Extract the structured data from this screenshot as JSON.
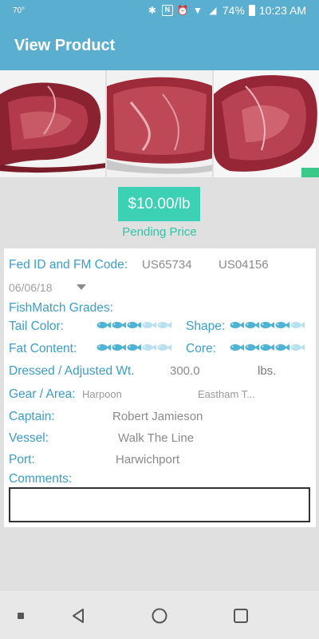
{
  "status_bar": {
    "temperature": "70°",
    "battery": "74%",
    "time": "10:23 AM"
  },
  "app_bar": {
    "title": "View Product"
  },
  "price": {
    "label": "$10.00/lb",
    "status": "Pending Price"
  },
  "product": {
    "fed_id_label": "Fed ID and FM Code:",
    "fed_id": "US65734",
    "fm_code": "US04156",
    "date": "06/06/18",
    "grades_label": "FishMatch Grades:",
    "tail_color_label": "Tail Color:",
    "tail_color_rating": 3,
    "shape_label": "Shape:",
    "shape_rating": 4,
    "fat_content_label": "Fat Content:",
    "fat_content_rating": 3,
    "core_label": "Core:",
    "core_rating": 4,
    "rating_max": 5,
    "weight_label": "Dressed / Adjusted Wt.",
    "weight_value": "300.0",
    "weight_unit": "lbs.",
    "gear_area_label": "Gear / Area:",
    "gear": "Harpoon",
    "area": "Eastham T...",
    "captain_label": "Captain:",
    "captain": "Robert Jamieson",
    "vessel_label": "Vessel:",
    "vessel": "Walk The Line",
    "port_label": "Port:",
    "port": "Harwichport",
    "comments_label": "Comments:",
    "comments": ""
  },
  "colors": {
    "primary": "#5aaed0",
    "accent": "#3cd0b4",
    "label": "#3a9ecc",
    "fish_filled": "#4fb3d6",
    "fish_empty": "#b7e1f0"
  }
}
